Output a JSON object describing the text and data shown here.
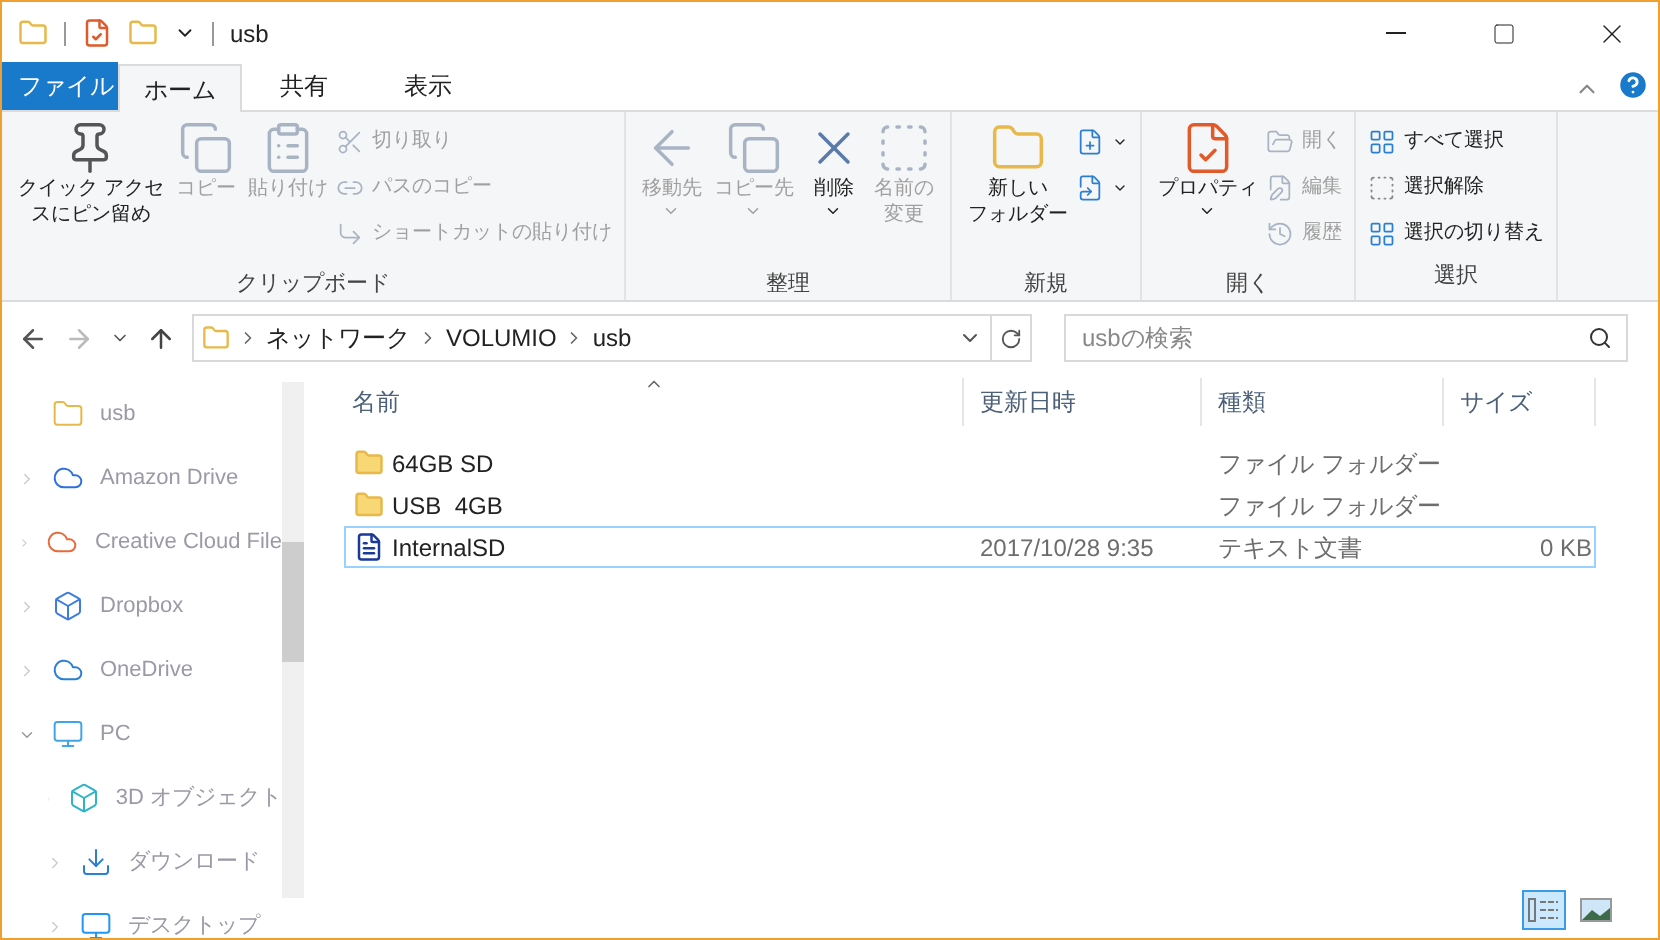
{
  "window": {
    "title": "usb"
  },
  "ribbon_tabs": [
    {
      "label": "ファイル",
      "kind": "file",
      "selected": false
    },
    {
      "label": "ホーム",
      "kind": "tab",
      "selected": true
    },
    {
      "label": "共有",
      "kind": "tab",
      "selected": false
    },
    {
      "label": "表示",
      "kind": "tab",
      "selected": false
    }
  ],
  "ribbon_groups": [
    {
      "label": "クリップボード",
      "items": [
        {
          "kind": "large",
          "lines": [
            "クイック アクセ",
            "スにピン留め"
          ],
          "disabled": false
        },
        {
          "kind": "large",
          "lines": [
            "コピー"
          ],
          "disabled": true
        },
        {
          "kind": "large",
          "lines": [
            "貼り付け"
          ],
          "disabled": true
        },
        {
          "kind": "stack",
          "children": [
            {
              "label": "切り取り",
              "disabled": true
            },
            {
              "label": "パスのコピー",
              "disabled": true
            },
            {
              "label": "ショートカットの貼り付け",
              "disabled": true
            }
          ]
        }
      ]
    },
    {
      "label": "整理",
      "items": [
        {
          "kind": "large",
          "lines": [
            "移動先"
          ],
          "disabled": true,
          "dropdown": true
        },
        {
          "kind": "large",
          "lines": [
            "コピー先"
          ],
          "disabled": true,
          "dropdown": true
        },
        {
          "kind": "large",
          "lines": [
            "削除"
          ],
          "disabled": false,
          "dropdown": true
        },
        {
          "kind": "large",
          "lines": [
            "名前の",
            "変更"
          ],
          "disabled": true
        }
      ]
    },
    {
      "label": "新規",
      "items": [
        {
          "kind": "large",
          "lines": [
            "新しい",
            "フォルダー"
          ],
          "disabled": false
        },
        {
          "kind": "stack",
          "children": [
            {
              "disabled": false
            },
            {
              "disabled": false
            }
          ]
        }
      ]
    },
    {
      "label": "開く",
      "items": [
        {
          "kind": "large",
          "lines": [
            "プロパティ"
          ],
          "disabled": false,
          "dropdown": true
        },
        {
          "kind": "stack",
          "children": [
            {
              "label": "開く",
              "disabled": true
            },
            {
              "label": "編集",
              "disabled": true
            },
            {
              "label": "履歴",
              "disabled": true
            }
          ]
        }
      ]
    },
    {
      "label": "選択",
      "items": [
        {
          "kind": "stack",
          "children": [
            {
              "label": "すべて選択",
              "disabled": false
            },
            {
              "label": "選択解除",
              "disabled": false
            },
            {
              "label": "選択の切り替え",
              "disabled": false
            }
          ]
        }
      ]
    }
  ],
  "address_bar": {
    "path": [
      "ネットワーク",
      "VOLUMIO",
      "usb"
    ]
  },
  "search": {
    "placeholder": "usbの検索"
  },
  "sidebar": {
    "items": [
      {
        "label": "usb"
      },
      {
        "label": "Amazon Drive"
      },
      {
        "label": "Creative Cloud File"
      },
      {
        "label": "Dropbox"
      },
      {
        "label": "OneDrive"
      },
      {
        "label": "PC",
        "children": [
          {
            "label": "3D オブジェクト"
          },
          {
            "label": "ダウンロード"
          },
          {
            "label": "デスクトップ"
          }
        ]
      }
    ]
  },
  "table": {
    "columns": [
      "名前",
      "更新日時",
      "種類",
      "サイズ"
    ],
    "rows": [
      {
        "kind": "folder",
        "name": "64GB SD",
        "type": "ファイル フォルダー",
        "selected": false
      },
      {
        "kind": "folder",
        "name": "USB  4GB",
        "type": "ファイル フォルダー",
        "selected": false
      },
      {
        "kind": "text",
        "name": "InternalSD",
        "modified": "2017/10/28 9:35",
        "type": "テキスト文書",
        "size": "0 KB",
        "selected": true
      }
    ]
  },
  "view_buttons": [
    {
      "kind": "details",
      "selected": true
    },
    {
      "kind": "thumbnails",
      "selected": false
    }
  ]
}
